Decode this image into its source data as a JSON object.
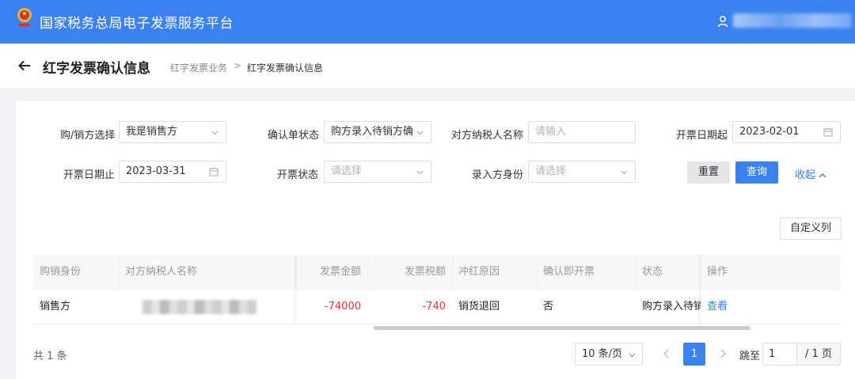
{
  "header": {
    "app_title": "国家税务总局电子发票服务平台"
  },
  "titlebar": {
    "title": "红字发票确认信息",
    "breadcrumb": [
      "红字发票业务",
      "红字发票确认信息"
    ],
    "breadcrumb_separator": ">"
  },
  "filters": {
    "buyer_seller": {
      "label": "购/销方选择",
      "value": "我是销售方"
    },
    "confirm_status": {
      "label": "确认单状态",
      "value": "购方录入待销方确"
    },
    "counterparty_name": {
      "label": "对方纳税人名称",
      "placeholder": "请输入"
    },
    "issue_date_start": {
      "label": "开票日期起",
      "value": "2023-02-01"
    },
    "issue_date_end": {
      "label": "开票日期止",
      "value": "2023-03-31"
    },
    "issue_status": {
      "label": "开票状态",
      "placeholder": "请选择"
    },
    "entry_identity": {
      "label": "录入方身份",
      "placeholder": "请选择"
    },
    "reset_label": "重置",
    "query_label": "查询",
    "collapse_label": "收起"
  },
  "table": {
    "custom_columns_label": "自定义列",
    "columns": [
      "购销身份",
      "对方纳税人名称",
      "发票金额",
      "发票税额",
      "冲红原因",
      "确认即开票",
      "状态",
      "操作"
    ],
    "rows": [
      {
        "identity": "销售方",
        "amount": "-74000",
        "tax": "-740",
        "reason": "销货退回",
        "confirm_issue": "否",
        "status": "购方录入待销",
        "action": "查看"
      }
    ]
  },
  "pagination": {
    "total": "共 1 条",
    "page_size": "10 条/页",
    "current_page": "1",
    "goto_label": "跳至",
    "goto_value": "1",
    "total_pages": "/ 1 页"
  },
  "colors": {
    "brand_blue": "#3b82f0",
    "negative_red": "#e53935"
  }
}
